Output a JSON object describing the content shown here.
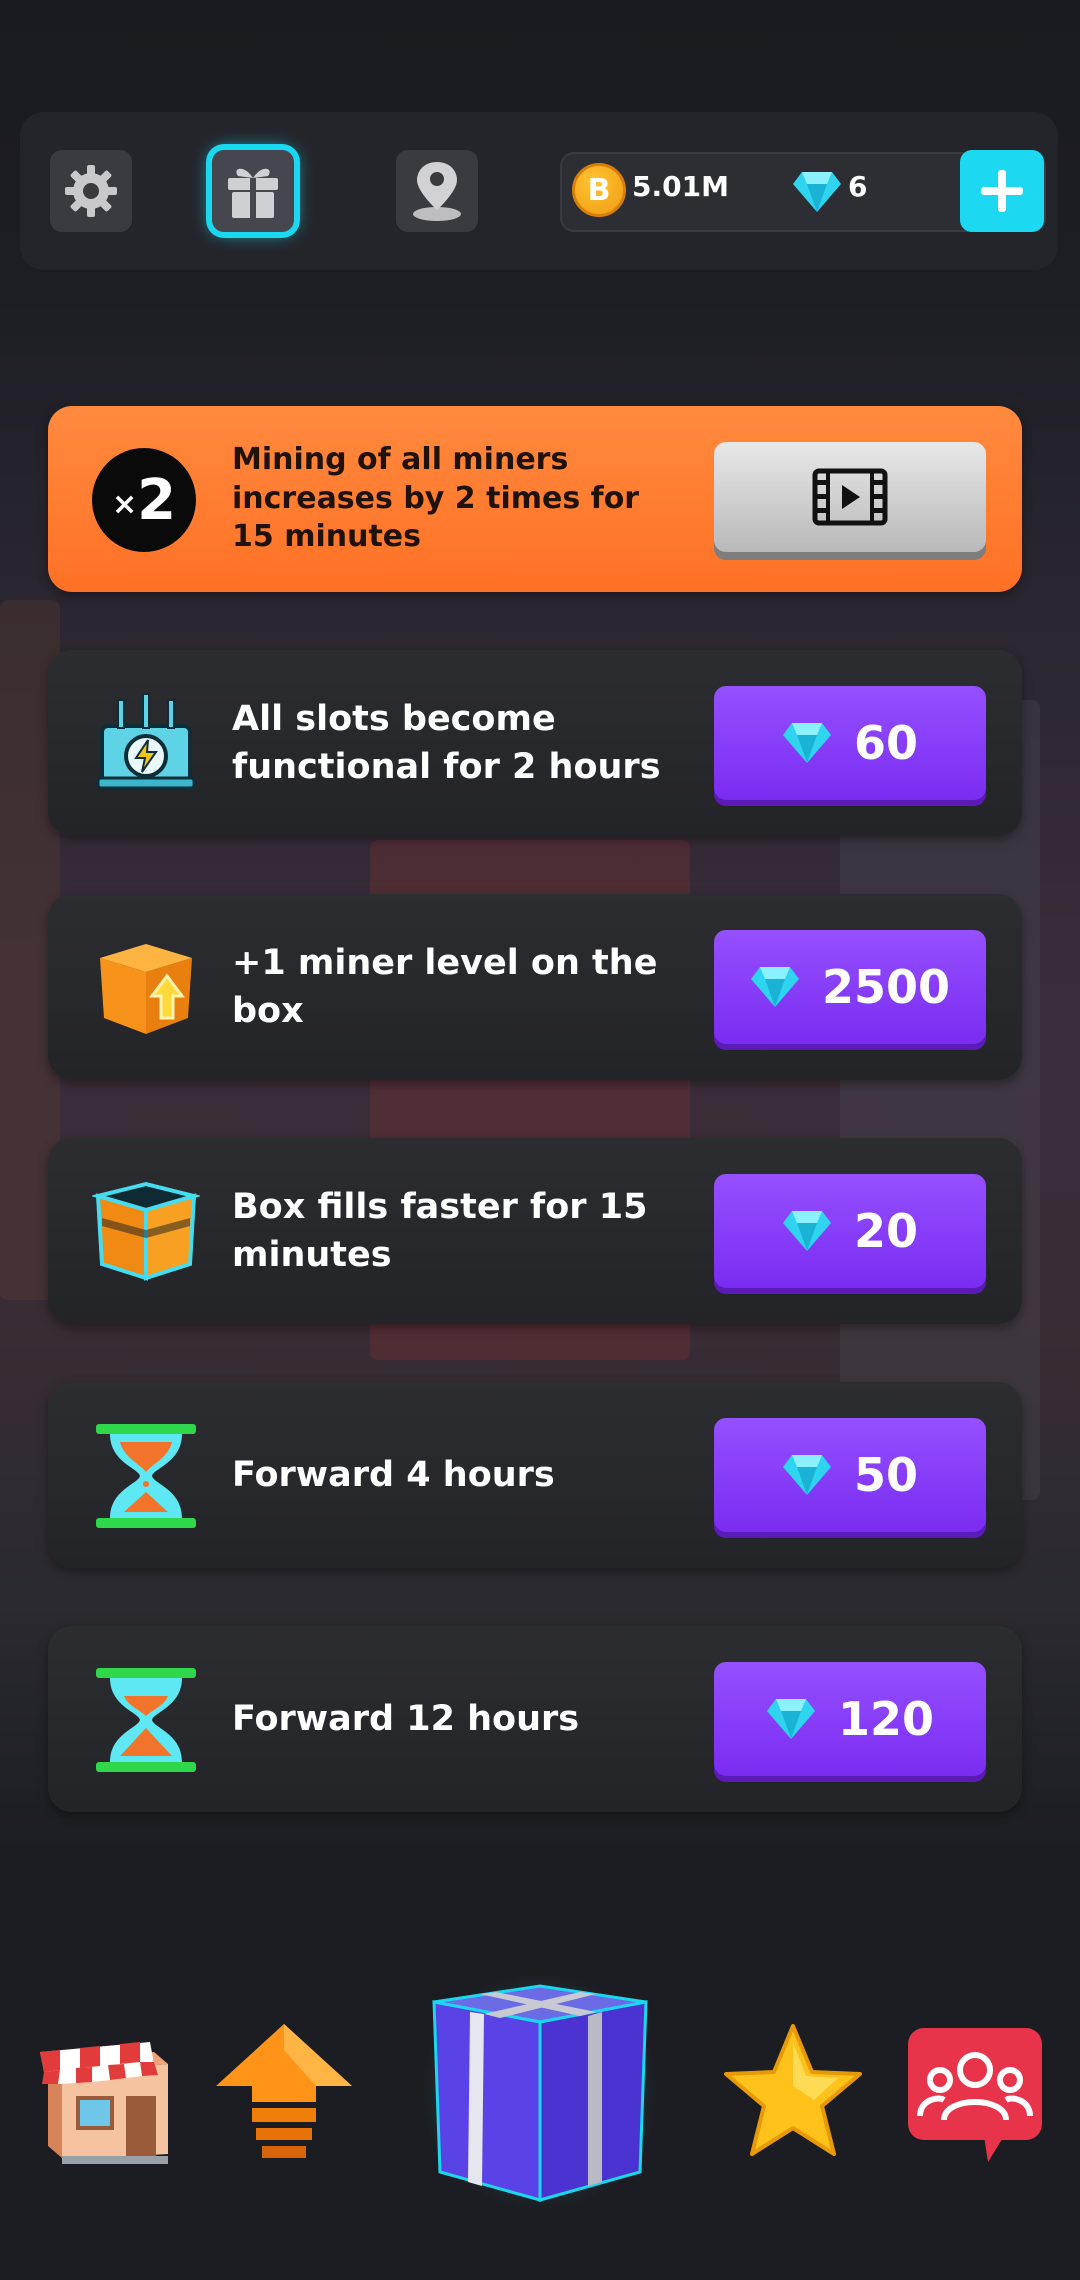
{
  "topbar": {
    "settings_icon": "gear-icon",
    "gift_icon": "gift-icon",
    "map_icon": "map-pin-icon",
    "coins": "5.01M",
    "coin_symbol": "B",
    "gems": "6",
    "add_icon": "plus-icon"
  },
  "boost": {
    "badge_prefix": "×",
    "badge_number": "2",
    "text": "Mining of all miners increases by 2 times for 15 minutes",
    "button_icon": "video-icon"
  },
  "offers": [
    {
      "icon": "power-slots-icon",
      "text": "All slots become functional for 2 hours",
      "price": "60"
    },
    {
      "icon": "box-level-up-icon",
      "text": "+1 miner level on the box",
      "price": "2500"
    },
    {
      "icon": "box-fill-icon",
      "text": "Box fills faster for 15 minutes",
      "price": "20"
    },
    {
      "icon": "hourglass-icon",
      "text": "Forward 4 hours",
      "price": "50"
    },
    {
      "icon": "hourglass-icon",
      "text": "Forward 12 hours",
      "price": "120"
    }
  ],
  "bottom_nav": [
    {
      "icon": "shop-icon"
    },
    {
      "icon": "upgrade-arrow-icon"
    },
    {
      "icon": "gift-box-icon"
    },
    {
      "icon": "star-icon"
    },
    {
      "icon": "friends-icon"
    }
  ],
  "colors": {
    "accent_cyan": "#19d8ef",
    "price_purple": "#8a3ff8",
    "boost_orange": "#ff7d30",
    "gem_cyan": "#2ee0f5"
  }
}
